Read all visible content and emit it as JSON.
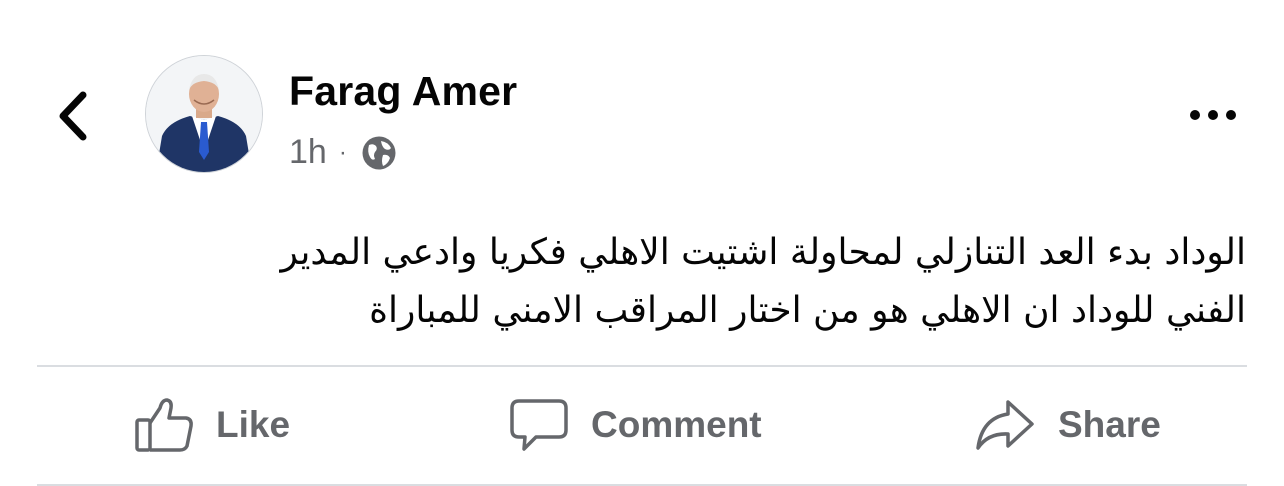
{
  "post": {
    "author": "Farag Amer",
    "time": "1h",
    "separator": "·",
    "text_lines": [
      "الوداد بدء العد التنازلي لمحاولة اشتيت الاهلي فكريا  وادعي المدير",
      "الفني للوداد ان الاهلي هو من اختار المراقب الامني للمباراة"
    ]
  },
  "actions": {
    "like": "Like",
    "comment": "Comment",
    "share": "Share"
  },
  "icons": {
    "back": "chevron-left-icon",
    "more": "more-dots-icon",
    "privacy": "globe-icon",
    "like": "thumbs-up-icon",
    "comment": "speech-bubble-icon",
    "share": "share-arrow-icon"
  },
  "colors": {
    "text": "#050505",
    "secondary": "#65676b",
    "divider": "#dadde1",
    "suit": "#1f3566",
    "tie": "#2a5bd0"
  }
}
